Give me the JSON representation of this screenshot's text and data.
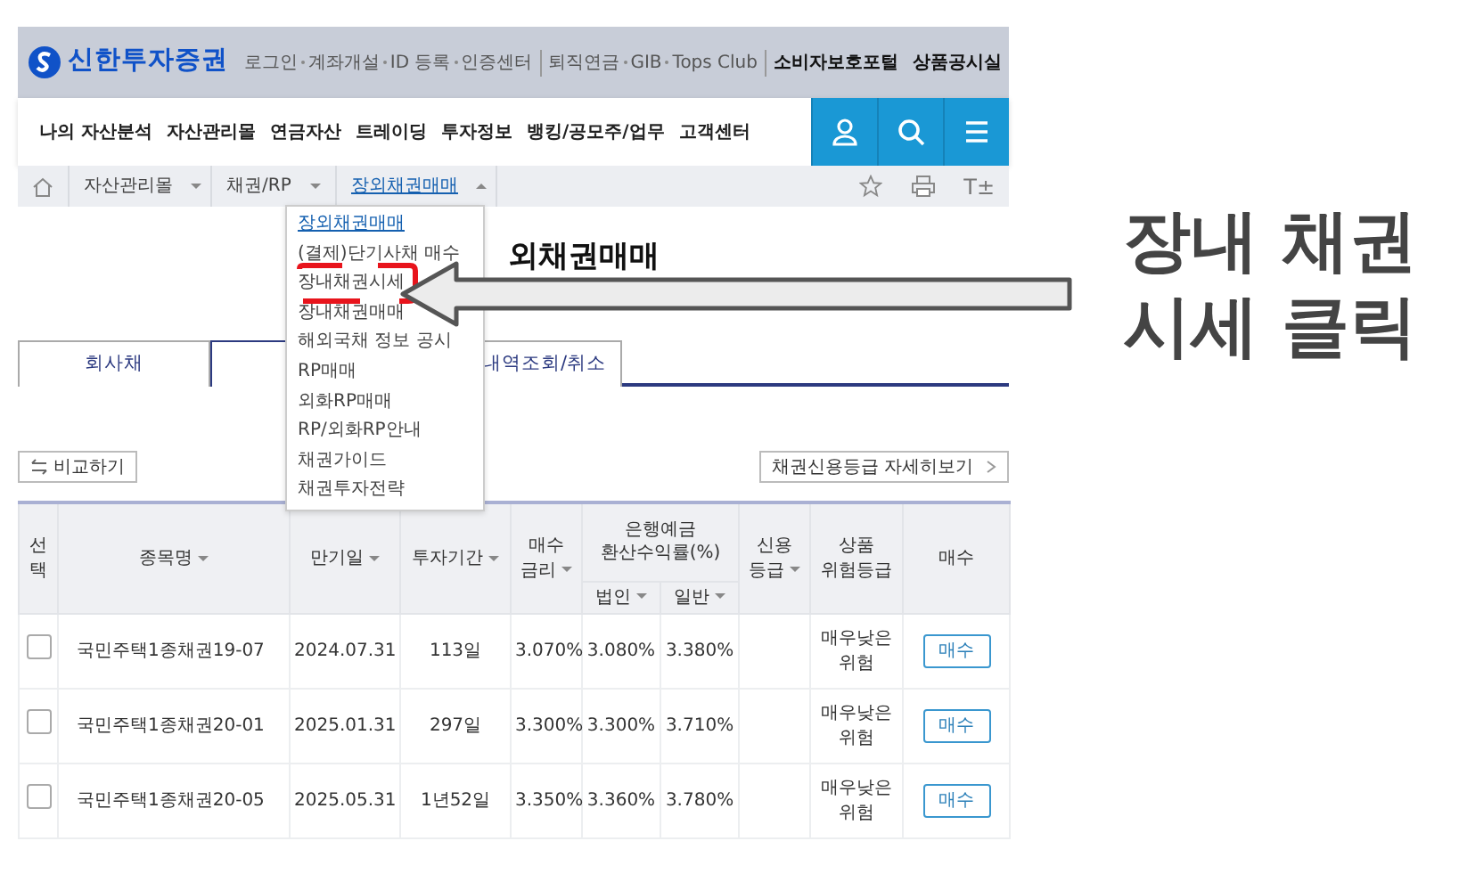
{
  "header": {
    "logo_text": "신한투자증권",
    "link_groups": [
      {
        "links": [
          "로그인",
          "계좌개설",
          "ID 등록",
          "인증센터"
        ],
        "bold": false
      },
      {
        "links": [
          "퇴직연금",
          "GIB",
          "Tops Club"
        ],
        "bold": false
      },
      {
        "links": [
          "소비자보호포털",
          "상품공시실"
        ],
        "bold": true
      }
    ]
  },
  "nav": {
    "items": [
      "나의 자산분석",
      "자산관리몰",
      "연금자산",
      "트레이딩",
      "투자정보",
      "뱅킹/공모주/업무",
      "고객센터"
    ]
  },
  "breadcrumb": {
    "items": [
      {
        "label": "자산관리몰",
        "expanded": false,
        "current": false
      },
      {
        "label": "채권/RP",
        "expanded": false,
        "current": false
      },
      {
        "label": "장외채권매매",
        "expanded": true,
        "current": true
      }
    ],
    "font_size_button": "T±"
  },
  "dropdown": {
    "items": [
      {
        "label": "장외채권매매",
        "selected": true,
        "highlighted": false
      },
      {
        "label": "(결제)단기사채 매수",
        "selected": false,
        "highlighted": false
      },
      {
        "label": "장내채권시세",
        "selected": false,
        "highlighted": true
      },
      {
        "label": "장내채권매매",
        "selected": false,
        "highlighted": false
      },
      {
        "label": "해외국채 정보 공시",
        "selected": false,
        "highlighted": false
      },
      {
        "label": "RP매매",
        "selected": false,
        "highlighted": false
      },
      {
        "label": "외화RP매매",
        "selected": false,
        "highlighted": false
      },
      {
        "label": "RP/외화RP안내",
        "selected": false,
        "highlighted": false
      },
      {
        "label": "채권가이드",
        "selected": false,
        "highlighted": false
      },
      {
        "label": "채권투자전략",
        "selected": false,
        "highlighted": false
      }
    ]
  },
  "page_title": "외채권매매",
  "tabs": [
    {
      "label": "회사채",
      "selected": false
    },
    {
      "selected": true
    },
    {
      "label": "내역조회/취소",
      "selected": false
    }
  ],
  "compare_button": "비교하기",
  "rating_link": "채권신용등급 자세히보기",
  "table": {
    "columns": [
      {
        "label": "선택",
        "sortable": false
      },
      {
        "label": "종목명",
        "sortable": true
      },
      {
        "label": "만기일",
        "sortable": true
      },
      {
        "label": "투자기간",
        "sortable": true
      },
      {
        "label": "매수 금리",
        "sortable": true
      },
      {
        "label": "은행예금 환산수익률(%)",
        "children": [
          {
            "label": "법인",
            "sortable": true
          },
          {
            "label": "일반",
            "sortable": true
          }
        ]
      },
      {
        "label": "신용 등급",
        "sortable": true
      },
      {
        "label": "상품 위험등급",
        "sortable": false
      },
      {
        "label": "매수",
        "sortable": false
      }
    ],
    "rows": [
      {
        "checked": false,
        "name": "국민주택1종채권19-07",
        "maturity": "2024.07.31",
        "period": "113일",
        "rate": "3.070%",
        "corporate": "3.080%",
        "general": "3.380%",
        "risk": "매우낮은위험",
        "buy": "매수"
      },
      {
        "checked": false,
        "name": "국민주택1종채권20-01",
        "maturity": "2025.01.31",
        "period": "297일",
        "rate": "3.300%",
        "corporate": "3.300%",
        "general": "3.710%",
        "risk": "매우낮은위험",
        "buy": "매수"
      },
      {
        "checked": false,
        "name": "국민주택1종채권20-05",
        "maturity": "2025.05.31",
        "period": "1년52일",
        "rate": "3.350%",
        "corporate": "3.360%",
        "general": "3.780%",
        "risk": "매우낮은위험",
        "buy": "매수"
      }
    ]
  },
  "annotation": {
    "lines": [
      "장내 채권",
      "시세 클릭"
    ]
  }
}
